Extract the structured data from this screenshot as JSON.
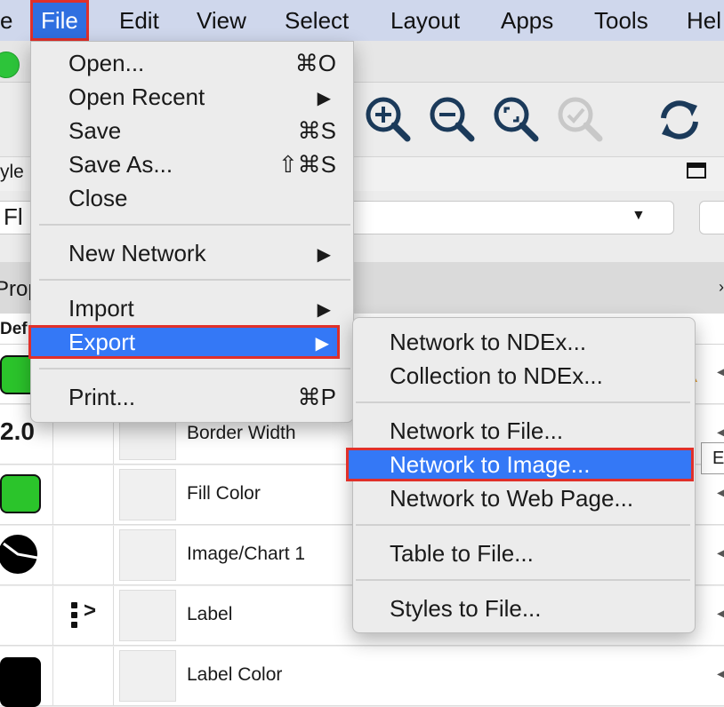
{
  "menubar": {
    "items": [
      {
        "label": "e"
      },
      {
        "label": "File"
      },
      {
        "label": "Edit"
      },
      {
        "label": "View"
      },
      {
        "label": "Select"
      },
      {
        "label": "Layout"
      },
      {
        "label": "Apps"
      },
      {
        "label": "Tools"
      },
      {
        "label": "Hel"
      }
    ]
  },
  "toolbar": {
    "icons": [
      "zoom-in-icon",
      "zoom-out-icon",
      "zoom-fit-icon",
      "zoom-selected-icon",
      "refresh-icon"
    ]
  },
  "style_panel": {
    "style_label": "yle",
    "combo_value": "Fl",
    "tab_label": "Prop",
    "header_label": "Def",
    "rows": [
      {
        "value": "",
        "name": ""
      },
      {
        "value": "2.0",
        "name": "Border Width"
      },
      {
        "value": "",
        "name": "Fill Color"
      },
      {
        "value": "",
        "name": "Image/Chart 1"
      },
      {
        "value": "",
        "name": "Label"
      },
      {
        "value": "",
        "name": "Label Color"
      }
    ]
  },
  "file_menu": {
    "items": [
      {
        "label": "Open...",
        "shortcut": "⌘O"
      },
      {
        "label": "Open Recent",
        "submenu": "▶"
      },
      {
        "label": "Save",
        "shortcut": "⌘S"
      },
      {
        "label": "Save As...",
        "shortcut": "⇧⌘S"
      },
      {
        "label": "Close"
      },
      {
        "label": "New Network",
        "submenu": "▶"
      },
      {
        "label": "Import",
        "submenu": "▶"
      },
      {
        "label": "Export",
        "submenu": "▶"
      },
      {
        "label": "Print...",
        "shortcut": "⌘P"
      }
    ]
  },
  "export_menu": {
    "items": [
      {
        "label": "Network to NDEx..."
      },
      {
        "label": "Collection to NDEx..."
      },
      {
        "label": "Network to File..."
      },
      {
        "label": "Network to Image..."
      },
      {
        "label": "Network to Web Page..."
      },
      {
        "label": "Table to File..."
      },
      {
        "label": "Styles to File..."
      }
    ]
  },
  "tooltip": {
    "text": "E"
  },
  "colors": {
    "menubar": "#cfd7ec",
    "selection": "#3478f6",
    "highlight_box": "#e0302a",
    "icon_navy": "#1b3a5a",
    "swatch_green": "#2bc42b"
  }
}
